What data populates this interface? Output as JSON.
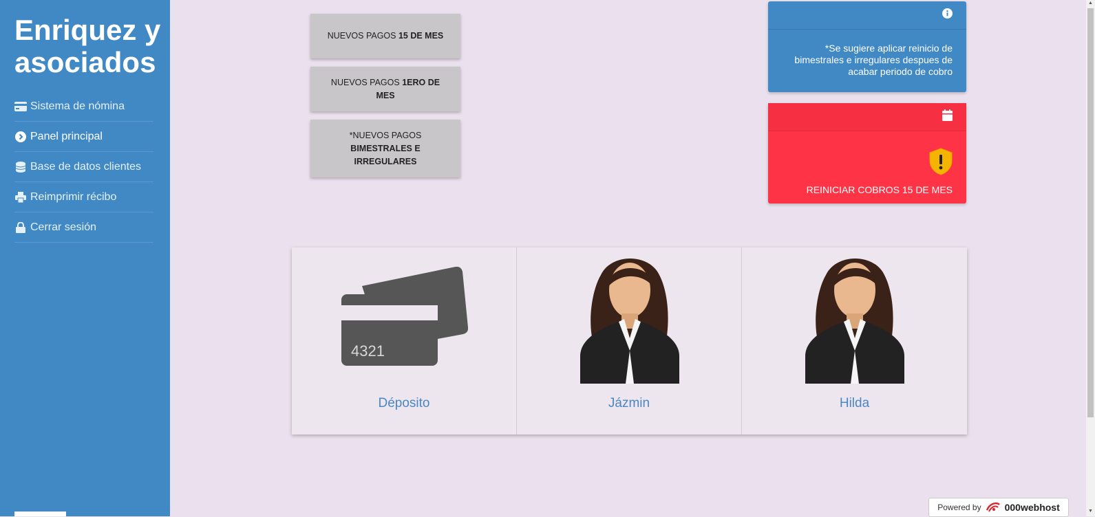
{
  "sidebar": {
    "brand": "Enriquez y asociados",
    "items": [
      {
        "label": "Sistema de nómina",
        "icon": "credit-card-icon"
      },
      {
        "label": "Panel principal",
        "icon": "chevron-circle-right-icon"
      },
      {
        "label": "Base de datos clientes",
        "icon": "database-icon"
      },
      {
        "label": "Reimprimir récibo",
        "icon": "printer-icon"
      },
      {
        "label": "Cerrar sesión",
        "icon": "lock-icon"
      }
    ]
  },
  "payments": {
    "btn1": {
      "prefix": "NUEVOS PAGOS ",
      "bold": "15 DE MES"
    },
    "btn2": {
      "prefix": "NUEVOS PAGOS ",
      "bold": "1ERO DE MES"
    },
    "btn3": {
      "prefix": "*NUEVOS PAGOS ",
      "bold": "BIMESTRALES E IRREGULARES"
    }
  },
  "info_card": {
    "text": "*Se sugiere aplicar reinicio de bimestrales e irregulares despues de acabar periodo de cobro",
    "icon": "info-icon",
    "color": "#4189c5"
  },
  "reset_card": {
    "label": "REINICIAR COBROS 15 DE MES",
    "icon": "calendar-icon",
    "badge_icon": "warning-shield-icon",
    "color": "#fe3346"
  },
  "profiles": [
    {
      "name": "Déposito",
      "image": "credit-card-image",
      "card_number": "4321"
    },
    {
      "name": "Jázmin",
      "image": "businesswoman-avatar"
    },
    {
      "name": "Hilda",
      "image": "businesswoman-avatar"
    }
  ],
  "footer": {
    "powered_by": "Powered by",
    "host": "000webhost"
  }
}
